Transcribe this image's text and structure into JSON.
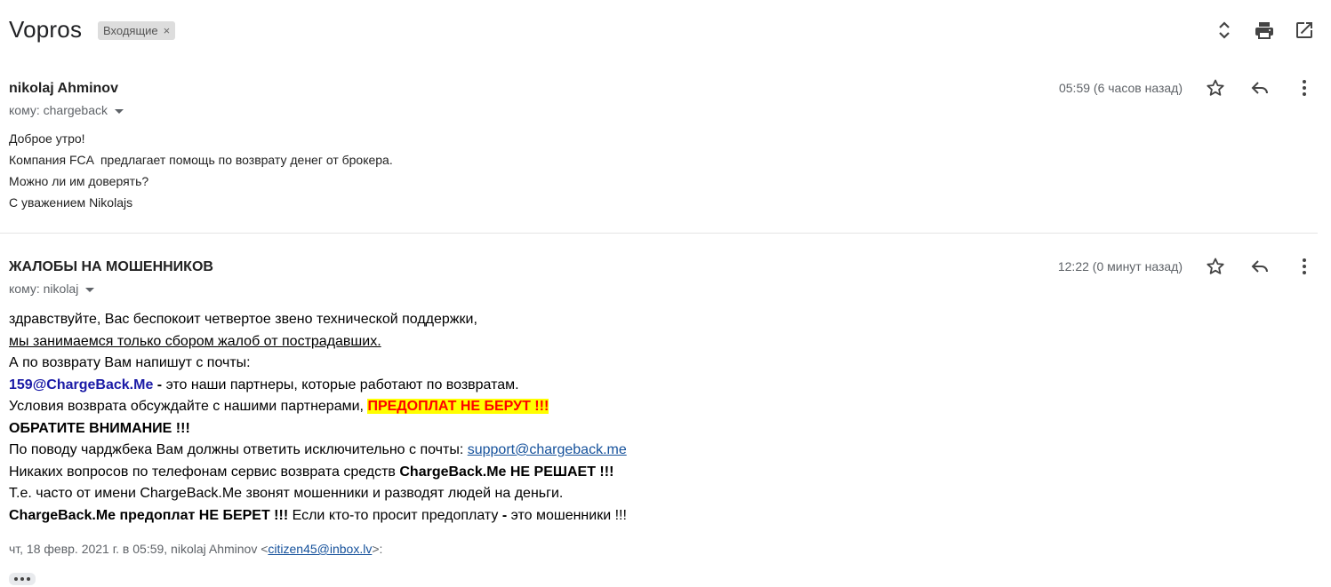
{
  "thread": {
    "subject": "Vopros",
    "label": "Входящие",
    "label_remove": "×",
    "icons": [
      "expand-collapse-icon",
      "print-icon",
      "open-in-new-window-icon"
    ]
  },
  "messages": [
    {
      "sender": "nikolaj Ahminov",
      "to": "кому: chargeback",
      "time": "05:59 (6 часов назад)",
      "body": [
        "Доброе утро!",
        "Компания FCA  предлагает помощь по возврату денег от брокера.",
        "Можно ли им доверять?",
        "С уважением Nikolajs"
      ]
    },
    {
      "sender": "ЖАЛОБЫ НА МОШЕННИКОВ",
      "to": "кому: nikolaj",
      "time": "12:22 (0 минут назад)",
      "body": {
        "line1": "здравствуйте, Вас беспокоит четвертое звено технической поддержки,",
        "line2": "мы занимаемся только сбором жалоб от пострадавших.",
        "line3": "А по возврату Вам напишут с почты:",
        "line4_email": "159@ChargeBack.Me",
        "line4_dash": " - ",
        "line4_rest": "это наши партнеры, которые работают по возвратам.",
        "line5_text": "Условия возврата обсуждайте с нашими партнерами, ",
        "line5_highlight": "ПРЕДОПЛАТ НЕ БЕРУТ !!!",
        "line6": "ОБРАТИТЕ ВНИМАНИЕ !!!",
        "line7_text": "По поводу чарджбека Вам должны ответить исключительно с почты: ",
        "line7_link": "support@chargeback.me",
        "line8_text": "Никаких вопросов по телефонам сервис возврата средств ",
        "line8_bold": "ChargeBack.Me НЕ РЕШАЕТ !!!",
        "line9": "Т.е. часто от имени ChargeBack.Me звонят мошенники и разводят людей на деньги.",
        "line10_bold": "ChargeBack.Me предоплат НЕ БЕРЕТ !!!",
        "line10_text": " Если кто-то просит предоплату ",
        "line10_dash": "-",
        "line10_end": " это мошенники !!!"
      },
      "quote_header_prefix": "чт, 18 февр. 2021 г. в 05:59, nikolaj Ahminov <",
      "quote_header_email": "citizen45@inbox.lv",
      "quote_header_suffix": ">:"
    }
  ],
  "colors": {
    "highlight_bg": "#ffff00",
    "highlight_text": "#ff0000",
    "partner_email": "#1a1aa6",
    "link": "#15519b"
  }
}
